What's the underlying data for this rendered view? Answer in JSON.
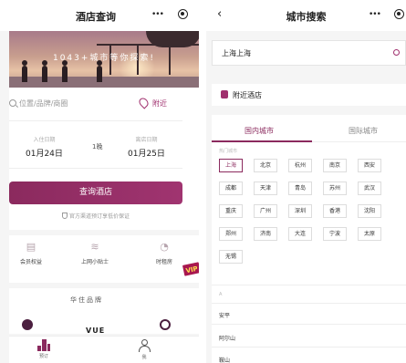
{
  "left": {
    "title": "酒店查询",
    "capsule_dots": "•••",
    "banner_text": "1043+城市等你探索!",
    "search": {
      "placeholder": "位置/品牌/商圈",
      "nearby_label": "附近"
    },
    "checkin": {
      "label": "入住日期",
      "value": "01月24日"
    },
    "nights": "1晚",
    "checkout": {
      "label": "离店日期",
      "value": "01月25日"
    },
    "query_button": "查询酒店",
    "guarantee_text": "官方渠道预订享低价保证",
    "services": [
      {
        "label": "会员权益",
        "icon": "member-card-icon"
      },
      {
        "label": "上网小贴士",
        "icon": "wifi-icon"
      },
      {
        "label": "时租房",
        "icon": "clock-icon"
      }
    ],
    "vip_badge": "VIP",
    "brands_title": "华住品牌",
    "brand_vue": "VUE",
    "tabs": {
      "booking": "预订",
      "mine": "我"
    }
  },
  "right": {
    "title": "城市搜索",
    "capsule_dots": "•••",
    "search_value": "上海上海",
    "nearby_hotel": "附近酒店",
    "tabs": {
      "domestic": "国内城市",
      "international": "国际城市"
    },
    "hot_label": "热门城市",
    "hot_cities": [
      "上海",
      "北京",
      "杭州",
      "南京",
      "西安",
      "成都",
      "天津",
      "青岛",
      "苏州",
      "武汉",
      "重庆",
      "广州",
      "深圳",
      "香港",
      "沈阳",
      "郑州",
      "济南",
      "大连",
      "宁波",
      "太原",
      "无锡"
    ],
    "selected_city": "上海",
    "index_letter": "A",
    "city_list": [
      "安平",
      "阿尔山",
      "鞍山"
    ]
  },
  "colors": {
    "accent": "#8b2a5e",
    "accent_light": "#a0306e"
  }
}
